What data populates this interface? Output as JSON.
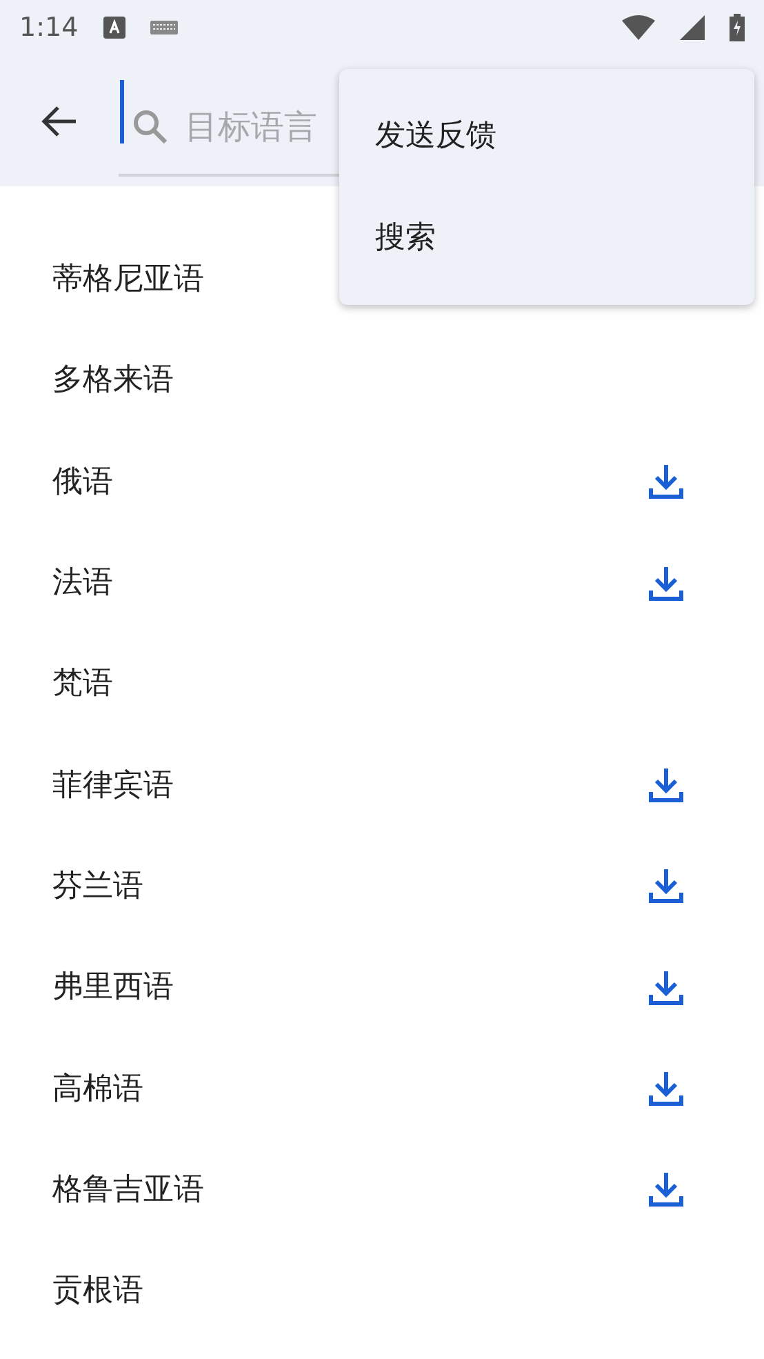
{
  "status_bar": {
    "time": "1:14"
  },
  "search": {
    "placeholder": "目标语言"
  },
  "languages": [
    {
      "name": "蒂格尼亚语"
    },
    {
      "name": "多格来语",
      "downloadable": false
    },
    {
      "name": "俄语",
      "downloadable": true
    },
    {
      "name": "法语",
      "downloadable": true
    },
    {
      "name": "梵语",
      "downloadable": false
    },
    {
      "name": "菲律宾语",
      "downloadable": true
    },
    {
      "name": "芬兰语",
      "downloadable": true
    },
    {
      "name": "弗里西语",
      "downloadable": true
    },
    {
      "name": "高棉语",
      "downloadable": true
    },
    {
      "name": "格鲁吉亚语",
      "downloadable": true
    },
    {
      "name": "贡根语",
      "downloadable": false
    }
  ],
  "menu": {
    "items": [
      "发送反馈",
      "搜索"
    ]
  }
}
